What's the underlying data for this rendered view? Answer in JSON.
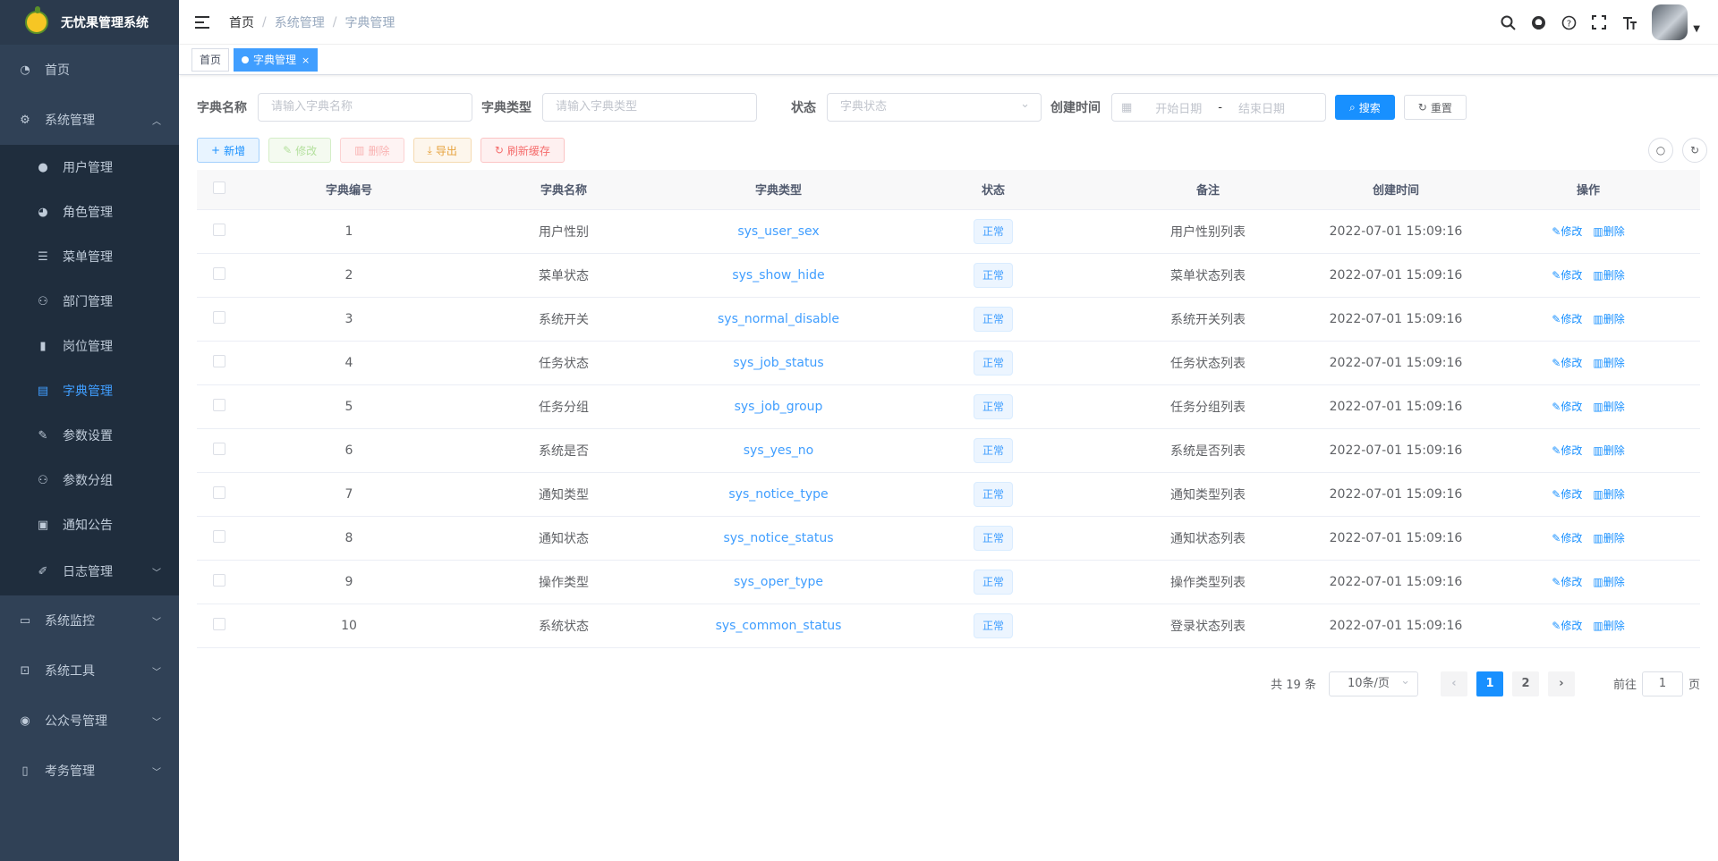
{
  "app": {
    "title": "无忧果管理系统"
  },
  "sidebar": {
    "items": [
      {
        "label": "首页",
        "icon": "dashboard-icon"
      },
      {
        "label": "系统管理",
        "icon": "gear-icon",
        "expanded": true,
        "children": [
          {
            "label": "用户管理",
            "icon": "user-icon"
          },
          {
            "label": "角色管理",
            "icon": "peoples-icon"
          },
          {
            "label": "菜单管理",
            "icon": "tree-table-icon"
          },
          {
            "label": "部门管理",
            "icon": "tree-icon"
          },
          {
            "label": "岗位管理",
            "icon": "post-icon"
          },
          {
            "label": "字典管理",
            "icon": "dict-icon",
            "active": true
          },
          {
            "label": "参数设置",
            "icon": "edit-icon"
          },
          {
            "label": "参数分组",
            "icon": "tree-icon"
          },
          {
            "label": "通知公告",
            "icon": "message-icon"
          },
          {
            "label": "日志管理",
            "icon": "log-icon"
          }
        ]
      },
      {
        "label": "系统监控",
        "icon": "monitor-icon"
      },
      {
        "label": "系统工具",
        "icon": "tool-icon"
      },
      {
        "label": "公众号管理",
        "icon": "wechat-icon"
      },
      {
        "label": "考务管理",
        "icon": "book-icon"
      }
    ]
  },
  "breadcrumb": [
    "首页",
    "系统管理",
    "字典管理"
  ],
  "tags": [
    {
      "label": "首页"
    },
    {
      "label": "字典管理",
      "active": true,
      "close": "×"
    }
  ],
  "search": {
    "name_label": "字典名称",
    "name_placeholder": "请输入字典名称",
    "type_label": "字典类型",
    "type_placeholder": "请输入字典类型",
    "status_label": "状态",
    "status_placeholder": "字典状态",
    "time_label": "创建时间",
    "start_placeholder": "开始日期",
    "end_placeholder": "结束日期",
    "range_sep": "-",
    "search_btn": "搜索",
    "reset_btn": "重置"
  },
  "toolbar": {
    "add": "新增",
    "edit": "修改",
    "delete": "删除",
    "export": "导出",
    "refresh": "刷新缓存"
  },
  "table": {
    "headers": [
      "字典编号",
      "字典名称",
      "字典类型",
      "状态",
      "备注",
      "创建时间",
      "操作"
    ],
    "edit_label": "修改",
    "delete_label": "删除",
    "rows": [
      {
        "id": "1",
        "name": "用户性别",
        "type": "sys_user_sex",
        "status": "正常",
        "remark": "用户性别列表",
        "time": "2022-07-01 15:09:16"
      },
      {
        "id": "2",
        "name": "菜单状态",
        "type": "sys_show_hide",
        "status": "正常",
        "remark": "菜单状态列表",
        "time": "2022-07-01 15:09:16"
      },
      {
        "id": "3",
        "name": "系统开关",
        "type": "sys_normal_disable",
        "status": "正常",
        "remark": "系统开关列表",
        "time": "2022-07-01 15:09:16"
      },
      {
        "id": "4",
        "name": "任务状态",
        "type": "sys_job_status",
        "status": "正常",
        "remark": "任务状态列表",
        "time": "2022-07-01 15:09:16"
      },
      {
        "id": "5",
        "name": "任务分组",
        "type": "sys_job_group",
        "status": "正常",
        "remark": "任务分组列表",
        "time": "2022-07-01 15:09:16"
      },
      {
        "id": "6",
        "name": "系统是否",
        "type": "sys_yes_no",
        "status": "正常",
        "remark": "系统是否列表",
        "time": "2022-07-01 15:09:16"
      },
      {
        "id": "7",
        "name": "通知类型",
        "type": "sys_notice_type",
        "status": "正常",
        "remark": "通知类型列表",
        "time": "2022-07-01 15:09:16"
      },
      {
        "id": "8",
        "name": "通知状态",
        "type": "sys_notice_status",
        "status": "正常",
        "remark": "通知状态列表",
        "time": "2022-07-01 15:09:16"
      },
      {
        "id": "9",
        "name": "操作类型",
        "type": "sys_oper_type",
        "status": "正常",
        "remark": "操作类型列表",
        "time": "2022-07-01 15:09:16"
      },
      {
        "id": "10",
        "name": "系统状态",
        "type": "sys_common_status",
        "status": "正常",
        "remark": "登录状态列表",
        "time": "2022-07-01 15:09:16"
      }
    ]
  },
  "pagination": {
    "total": "共 19 条",
    "page_size": "10条/页",
    "pages": [
      "1",
      "2"
    ],
    "current": "1",
    "goto_label": "前往",
    "goto_value": "1",
    "page_unit": "页"
  },
  "colors": {
    "primary": "#1890ff",
    "sidebar_bg": "#304156",
    "submenu_bg": "#1f2d3d",
    "active_text": "#409eff"
  }
}
